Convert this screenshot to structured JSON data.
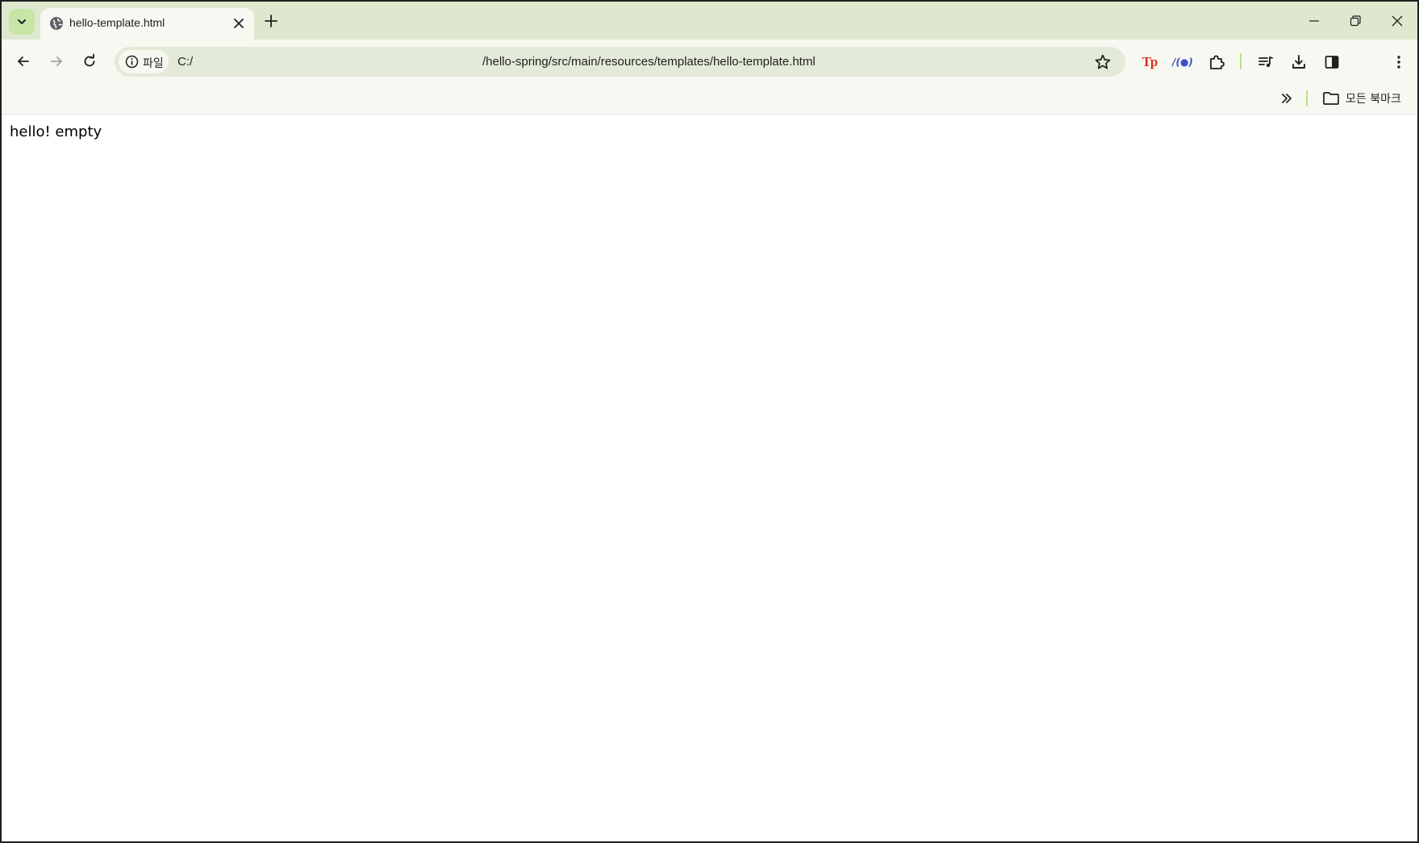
{
  "browser": {
    "tab": {
      "title": "hello-template.html",
      "favicon": "globe-icon"
    },
    "address_bar": {
      "site_chip_label": "파일",
      "url_prefix": "C:/",
      "url_path": "/hello-spring/src/main/resources/templates/hello-template.html"
    },
    "extensions": {
      "tp_label": "Tp",
      "api_label": "/(●)"
    },
    "bookmarks_bar": {
      "folder_label": "모든 북마크"
    },
    "colors": {
      "tabstrip_bg": "#dde8cf",
      "toolbar_bg": "#f7f8f1",
      "omnibox_bg": "#e4ead8",
      "accent_green": "#b8e08a",
      "tp_red": "#d93025",
      "api_blue": "#3c4ec9"
    }
  },
  "page": {
    "text": "hello! empty"
  }
}
